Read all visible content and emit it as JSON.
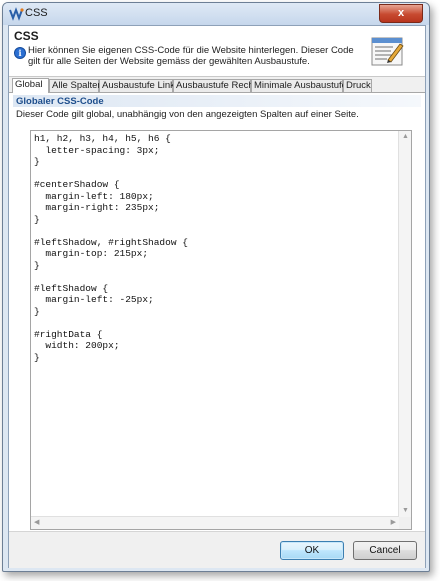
{
  "window": {
    "title": "CSS",
    "close_label": "x"
  },
  "header": {
    "title": "CSS",
    "info_icon": "info-icon",
    "description": "Hier können Sie eigenen CSS-Code für die Website hinterlegen. Dieser Code gilt für alle Seiten der Website gemäss der gewählten Ausbaustufe."
  },
  "tabs": [
    {
      "label": "Global",
      "active": true
    },
    {
      "label": "Alle Spalten",
      "active": false
    },
    {
      "label": "Ausbaustufe Links",
      "active": false
    },
    {
      "label": "Ausbaustufe Rechts",
      "active": false
    },
    {
      "label": "Minimale Ausbaustufe",
      "active": false
    },
    {
      "label": "Druck",
      "active": false
    }
  ],
  "section": {
    "title": "Globaler CSS-Code",
    "description": "Dieser Code gilt global, unabhängig von den angezeigten Spalten auf einer Seite."
  },
  "editor": {
    "code": "h1, h2, h3, h4, h5, h6 {\n  letter-spacing: 3px;\n}\n\n#centerShadow {\n  margin-left: 180px;\n  margin-right: 235px;\n}\n\n#leftShadow, #rightShadow {\n  margin-top: 215px;\n}\n\n#leftShadow {\n  margin-left: -25px;\n}\n\n#rightData {\n  width: 200px;\n}"
  },
  "buttons": {
    "ok": "OK",
    "cancel": "Cancel"
  },
  "colors": {
    "accent": "#1e4e8c",
    "close": "#c74a30"
  }
}
